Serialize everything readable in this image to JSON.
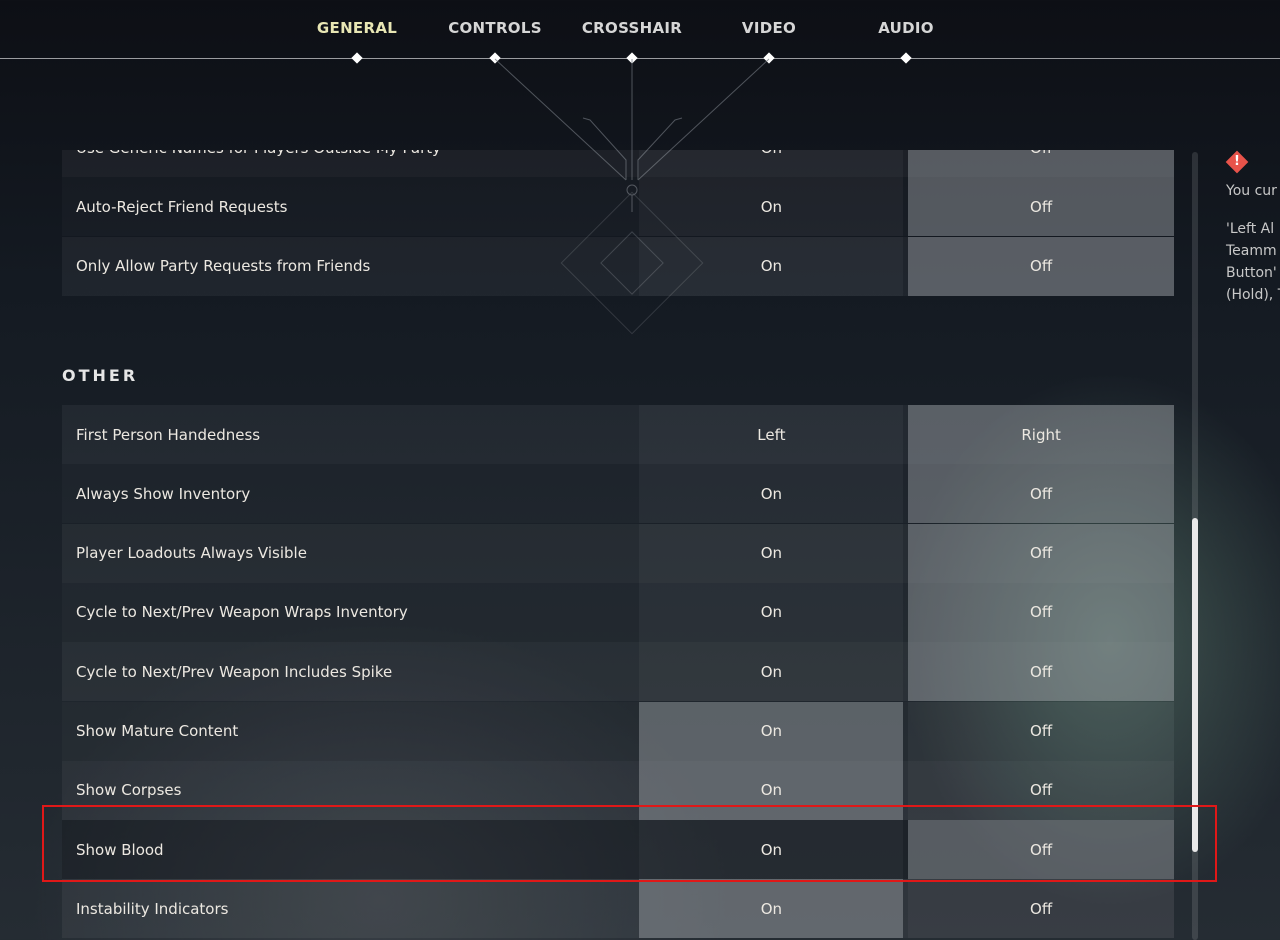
{
  "nav": {
    "tabs": [
      {
        "label": "GENERAL",
        "active": true
      },
      {
        "label": "CONTROLS"
      },
      {
        "label": "CROSSHAIR"
      },
      {
        "label": "VIDEO"
      },
      {
        "label": "AUDIO"
      }
    ]
  },
  "rows_top": [
    {
      "label": "Use Generic Names for Players Outside My Party",
      "a": "On",
      "b": "Off",
      "selected": "b"
    },
    {
      "label": "Auto-Reject Friend Requests",
      "a": "On",
      "b": "Off",
      "selected": "b"
    },
    {
      "label": "Only Allow Party Requests from Friends",
      "a": "On",
      "b": "Off",
      "selected": "b"
    }
  ],
  "section_other": "OTHER",
  "rows_other": [
    {
      "label": "First Person Handedness",
      "a": "Left",
      "b": "Right",
      "selected": "b"
    },
    {
      "label": "Always Show Inventory",
      "a": "On",
      "b": "Off",
      "selected": "b"
    },
    {
      "label": "Player Loadouts Always Visible",
      "a": "On",
      "b": "Off",
      "selected": "b"
    },
    {
      "label": "Cycle to Next/Prev Weapon Wraps Inventory",
      "a": "On",
      "b": "Off",
      "selected": "b"
    },
    {
      "label": "Cycle to Next/Prev Weapon Includes Spike",
      "a": "On",
      "b": "Off",
      "selected": "b"
    },
    {
      "label": "Show Mature Content",
      "a": "On",
      "b": "Off",
      "selected": "a"
    },
    {
      "label": "Show Corpses",
      "a": "On",
      "b": "Off",
      "selected": "a"
    },
    {
      "label": "Show Blood",
      "a": "On",
      "b": "Off",
      "selected": "b"
    },
    {
      "label": "Instability Indicators",
      "a": "On",
      "b": "Off",
      "selected": "a"
    }
  ],
  "side": {
    "icon": "warning-icon",
    "lines": [
      "You cur",
      "",
      "'Left Al",
      "Teamm",
      "Button'",
      "(Hold), T"
    ]
  },
  "colors": {
    "highlight_box": "#e01818",
    "active_tab": "#e8e6b4",
    "warning": "#e8534a"
  }
}
